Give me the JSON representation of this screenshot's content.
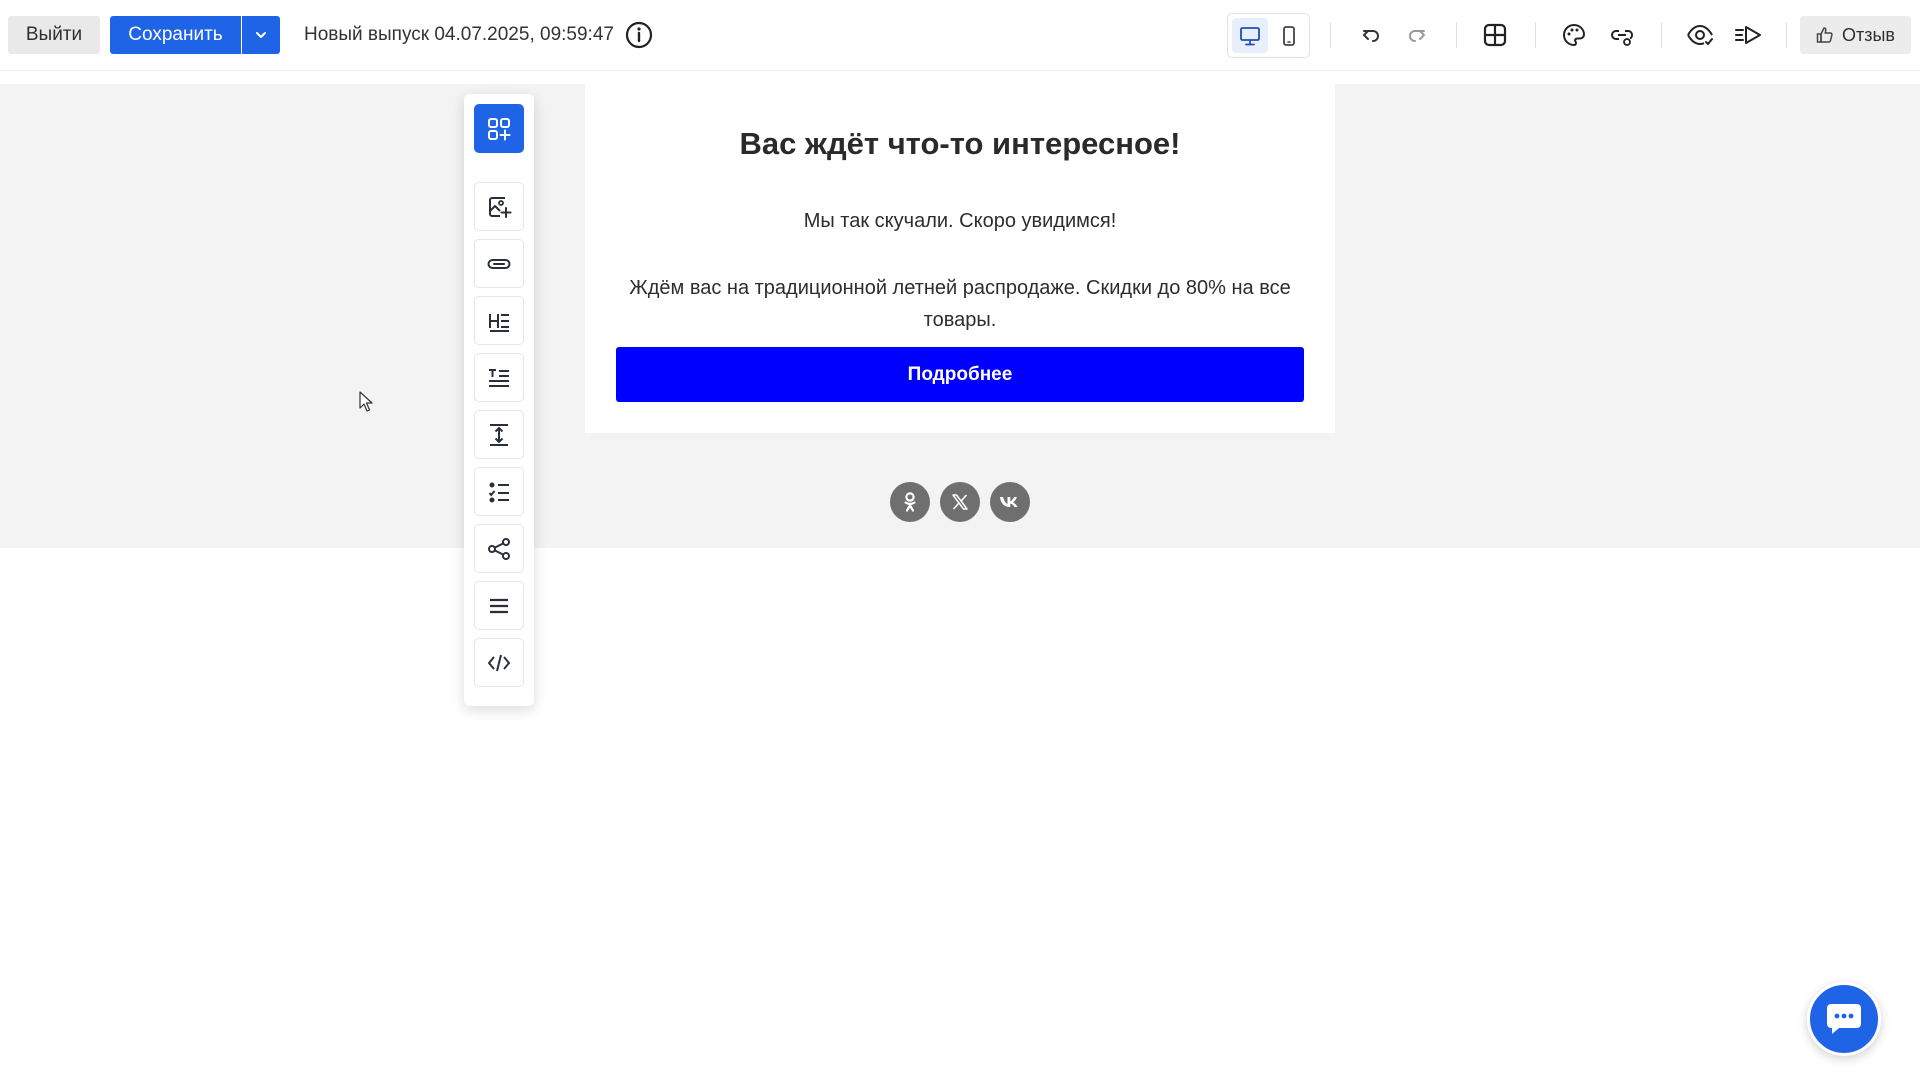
{
  "toolbar": {
    "exit_label": "Выйти",
    "save_label": "Сохранить",
    "release_title": "Новый выпуск 04.07.2025, 09:59:47",
    "feedback_label": "Отзыв",
    "icons": [
      "info-icon",
      "desktop-icon",
      "mobile-icon",
      "undo-icon",
      "redo-icon",
      "layout-grid-icon",
      "palette-icon",
      "link-settings-icon",
      "preview-icon",
      "send-test-icon",
      "thumbs-up-icon",
      "chevron-down-icon"
    ],
    "accent_color": "#1f64e6"
  },
  "email": {
    "title": "Вас ждёт что-то интересное!",
    "paragraph1": "Мы так скучали. Скоро увидимся!",
    "paragraph2": "Ждём вас на традиционной летней распродаже. Скидки до 80% на все товары.",
    "cta_label": "Подробнее",
    "cta_color": "#0000ff",
    "socials": [
      "odnoklassniki-icon",
      "x-twitter-icon",
      "vk-icon"
    ]
  },
  "blocks_panel": {
    "items": [
      "add-block-icon",
      "image-block-icon",
      "button-block-icon",
      "heading-block-icon",
      "text-block-icon",
      "spacer-block-icon",
      "list-block-icon",
      "social-block-icon",
      "menu-block-icon",
      "html-block-icon"
    ]
  },
  "chat": {
    "icon": "chat-bubble-icon"
  }
}
